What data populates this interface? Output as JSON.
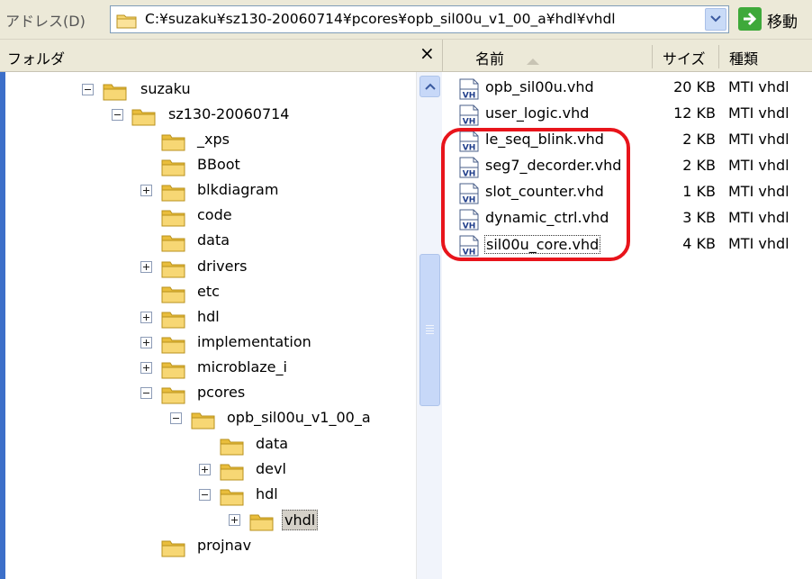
{
  "address_bar": {
    "label": "アドレス(D)",
    "path": "C:¥suzaku¥sz130-20060714¥pcores¥opb_sil00u_v1_00_a¥hdl¥vhdl",
    "go_label": "移動"
  },
  "folder_pane": {
    "title": "フォルダ",
    "close": "×",
    "tree": [
      {
        "label": "suzaku",
        "expander": "minus"
      },
      {
        "label": "sz130-20060714",
        "expander": "minus"
      },
      {
        "label": "_xps",
        "expander": "none"
      },
      {
        "label": "BBoot",
        "expander": "none"
      },
      {
        "label": "blkdiagram",
        "expander": "plus"
      },
      {
        "label": "code",
        "expander": "none"
      },
      {
        "label": "data",
        "expander": "none"
      },
      {
        "label": "drivers",
        "expander": "plus"
      },
      {
        "label": "etc",
        "expander": "none"
      },
      {
        "label": "hdl",
        "expander": "plus"
      },
      {
        "label": "implementation",
        "expander": "plus"
      },
      {
        "label": "microblaze_i",
        "expander": "plus"
      },
      {
        "label": "pcores",
        "expander": "minus"
      },
      {
        "label": "opb_sil00u_v1_00_a",
        "expander": "minus"
      },
      {
        "label": "data",
        "expander": "none"
      },
      {
        "label": "devl",
        "expander": "plus"
      },
      {
        "label": "hdl",
        "expander": "minus"
      },
      {
        "label": "vhdl",
        "expander": "plus",
        "selected": true
      },
      {
        "label": "projnav",
        "expander": "none"
      }
    ]
  },
  "file_list": {
    "columns": {
      "name": "名前",
      "size": "サイズ",
      "type": "種類"
    },
    "files": [
      {
        "name": "opb_sil00u.vhd",
        "size": "20 KB",
        "type": "MTI vhdl"
      },
      {
        "name": "user_logic.vhd",
        "size": "12 KB",
        "type": "MTI vhdl"
      },
      {
        "name": "le_seq_blink.vhd",
        "size": "2 KB",
        "type": "MTI vhdl"
      },
      {
        "name": "seg7_decorder.vhd",
        "size": "2 KB",
        "type": "MTI vhdl"
      },
      {
        "name": "slot_counter.vhd",
        "size": "1 KB",
        "type": "MTI vhdl"
      },
      {
        "name": "dynamic_ctrl.vhd",
        "size": "3 KB",
        "type": "MTI vhdl"
      },
      {
        "name": "sil00u_core.vhd",
        "size": "4 KB",
        "type": "MTI vhdl",
        "focused": true
      }
    ],
    "icon_text": "VH"
  },
  "colors": {
    "folder": "#f7d774",
    "highlight": "#e8141b",
    "go_arrow": "#3ea93a"
  }
}
